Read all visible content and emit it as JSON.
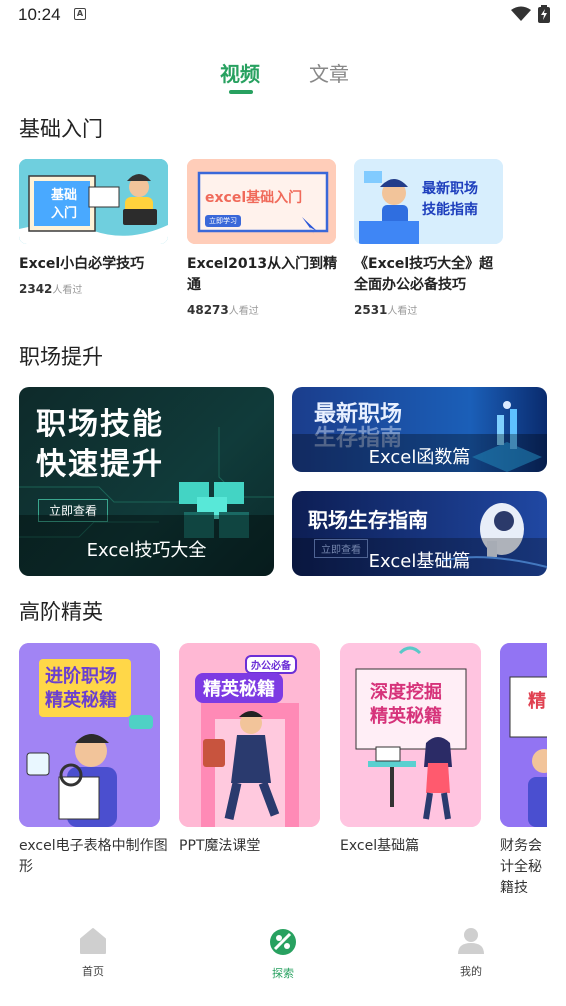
{
  "status": {
    "time": "10:24",
    "notification_icon": "A"
  },
  "tabs": {
    "video": "视频",
    "article": "文章"
  },
  "sections": {
    "basic": "基础入门",
    "workplace": "职场提升",
    "elite": "高阶精英"
  },
  "basic_courses": [
    {
      "thumb_text_1": "基础",
      "thumb_text_2": "入门",
      "title": "Excel小白必学技巧",
      "views": "2342",
      "views_suffix": "人看过"
    },
    {
      "thumb_text_1": "excel基础入门",
      "thumb_text_2": "立即学习",
      "title": "Excel2013从入门到精通",
      "views": "48273",
      "views_suffix": "人看过"
    },
    {
      "thumb_text_1": "最新职场",
      "thumb_text_2": "技能指南",
      "title": "《Excel技巧大全》超全面办公必备技巧",
      "views": "2531",
      "views_suffix": "人看过"
    }
  ],
  "workplace": {
    "big": {
      "line1": "职场技能",
      "line2": "快速提升",
      "button": "立即查看",
      "caption": "Excel技巧大全"
    },
    "small1": {
      "line1": "最新职场",
      "line2": "生存指南",
      "caption": "Excel函数篇"
    },
    "small2": {
      "line1": "职场生存指南",
      "button": "立即查看",
      "caption": "Excel基础篇"
    }
  },
  "elite_courses": [
    {
      "thumb_line1": "进阶职场",
      "thumb_line2": "精英秘籍",
      "title": "excel电子表格中制作图形"
    },
    {
      "thumb_tag": "办公必备",
      "thumb_line1": "精英秘籍",
      "title": "PPT魔法课堂"
    },
    {
      "thumb_line1": "深度挖掘",
      "thumb_line2": "精英秘籍",
      "title": "Excel基础篇"
    },
    {
      "thumb_line1": "精",
      "title": "财务会计全秘籍技"
    }
  ],
  "nav": {
    "home": "首页",
    "explore": "探索",
    "mine": "我的"
  },
  "colors": {
    "accent": "#28a160"
  }
}
